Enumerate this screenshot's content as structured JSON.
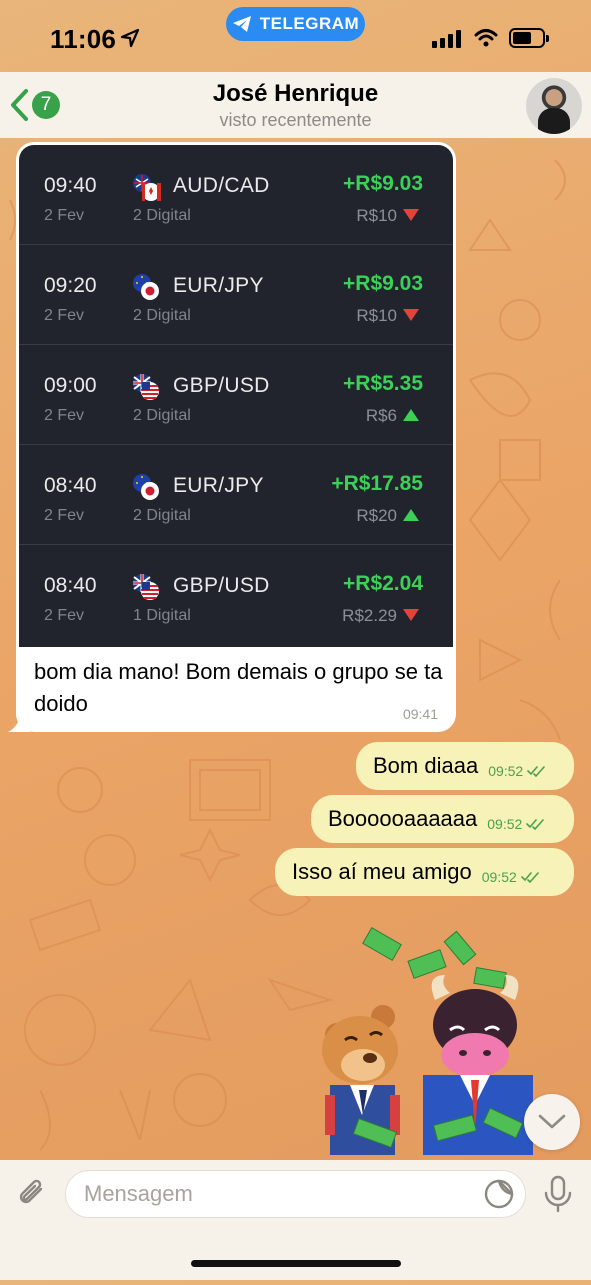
{
  "status_bar": {
    "time": "11:06",
    "app_pill": "TELEGRAM"
  },
  "header": {
    "back_badge": "7",
    "contact_name": "José Henrique",
    "contact_status": "visto recentemente"
  },
  "trades": [
    {
      "time": "09:40",
      "date": "2 Fev",
      "pair": "AUD/CAD",
      "type": "2 Digital",
      "profit": "+R$9.03",
      "amount": "R$10",
      "direction": "down",
      "flag": "au-ca"
    },
    {
      "time": "09:20",
      "date": "2 Fev",
      "pair": "EUR/JPY",
      "type": "2 Digital",
      "profit": "+R$9.03",
      "amount": "R$10",
      "direction": "down",
      "flag": "eu-jp"
    },
    {
      "time": "09:00",
      "date": "2 Fev",
      "pair": "GBP/USD",
      "type": "2 Digital",
      "profit": "+R$5.35",
      "amount": "R$6",
      "direction": "up",
      "flag": "gb-us"
    },
    {
      "time": "08:40",
      "date": "2 Fev",
      "pair": "EUR/JPY",
      "type": "2 Digital",
      "profit": "+R$17.85",
      "amount": "R$20",
      "direction": "up",
      "flag": "eu-jp"
    },
    {
      "time": "08:40",
      "date": "2 Fev",
      "pair": "GBP/USD",
      "type": "1 Digital",
      "profit": "+R$2.04",
      "amount": "R$2.29",
      "direction": "down",
      "flag": "gb-us"
    }
  ],
  "incoming_message": {
    "text": "bom dia mano! Bom demais o grupo se ta doido",
    "time": "09:41"
  },
  "outgoing_messages": [
    {
      "text": "Bom diaaa",
      "time": "09:52"
    },
    {
      "text": "Boooooaaaaaa",
      "time": "09:52"
    },
    {
      "text": "Isso aí meu amigo",
      "time": "09:52"
    }
  ],
  "input": {
    "placeholder": "Mensagem"
  },
  "colors": {
    "profit": "#3bd058",
    "down": "#e0453c",
    "up": "#3bd058",
    "outgoing_bubble": "#f7f2b7",
    "telegram_blue": "#2a8bf2"
  }
}
